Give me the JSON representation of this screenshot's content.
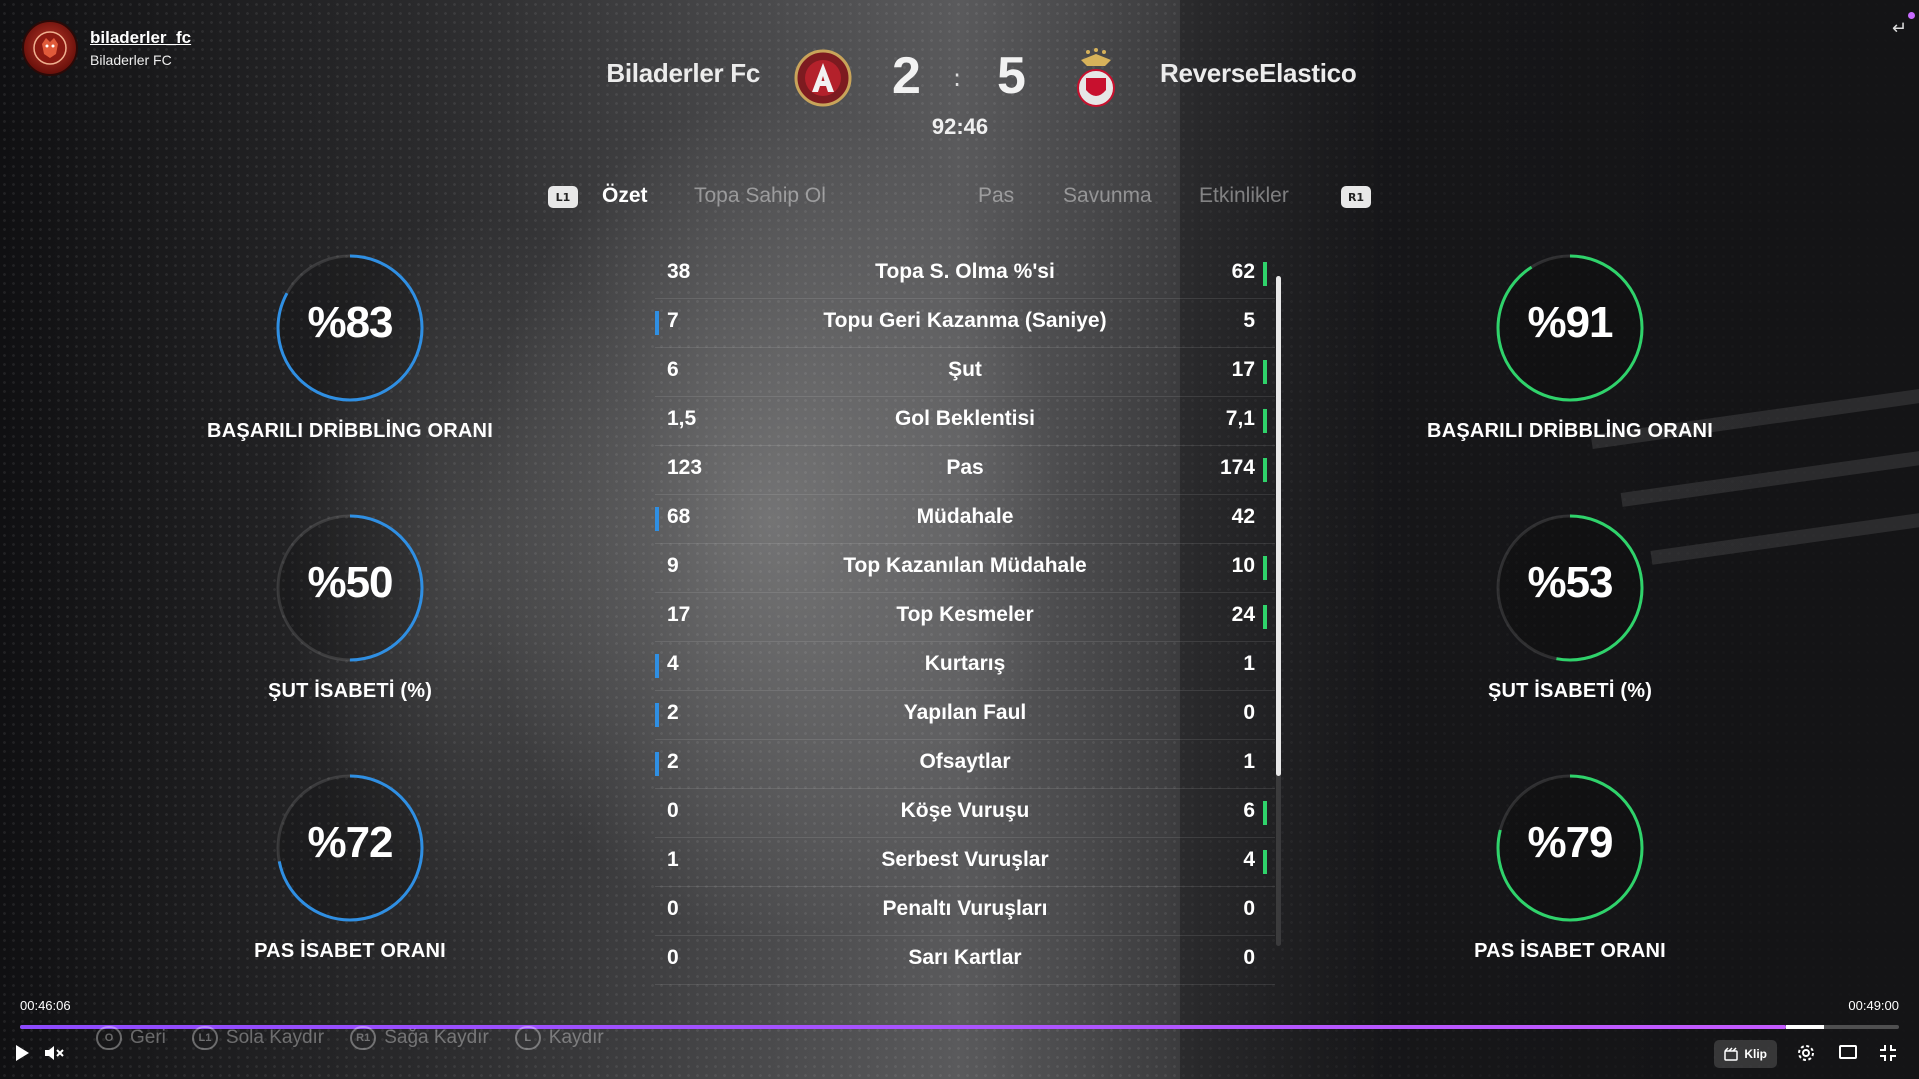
{
  "channel": {
    "name": "biladerler_fc",
    "subtitle": "Biladerler FC"
  },
  "match": {
    "home_team": "Biladerler Fc",
    "away_team": "ReverseElastico",
    "home_score": "2",
    "away_score": "5",
    "separator": ":",
    "clock": "92:46"
  },
  "tabs": {
    "prev_button": "L1",
    "next_button": "R1",
    "items": [
      "Özet",
      "Topa Sahip Ol",
      "Pas",
      "Savunma",
      "Etkinlikler"
    ],
    "active": "Özet"
  },
  "home_rings": [
    {
      "value": "%83",
      "label": "BAŞARILI DRİBBLİNG ORANI",
      "percent": 83
    },
    {
      "value": "%50",
      "label": "ŞUT İSABETİ (%)",
      "percent": 50
    },
    {
      "value": "%72",
      "label": "PAS İSABET ORANI",
      "percent": 72
    }
  ],
  "away_rings": [
    {
      "value": "%91",
      "label": "BAŞARILI DRİBBLİNG ORANI",
      "percent": 91
    },
    {
      "value": "%53",
      "label": "ŞUT İSABETİ (%)",
      "percent": 53
    },
    {
      "value": "%79",
      "label": "PAS İSABET ORANI",
      "percent": 79
    }
  ],
  "stats": [
    {
      "name": "Topa S. Olma %'si",
      "home": "38",
      "away": "62"
    },
    {
      "name": "Topu Geri Kazanma (Saniye)",
      "home": "7",
      "away": "5"
    },
    {
      "name": "Şut",
      "home": "6",
      "away": "17"
    },
    {
      "name": "Gol Beklentisi",
      "home": "1,5",
      "away": "7,1"
    },
    {
      "name": "Pas",
      "home": "123",
      "away": "174"
    },
    {
      "name": "Müdahale",
      "home": "68",
      "away": "42"
    },
    {
      "name": "Top Kazanılan Müdahale",
      "home": "9",
      "away": "10"
    },
    {
      "name": "Top Kesmeler",
      "home": "17",
      "away": "24"
    },
    {
      "name": "Kurtarış",
      "home": "4",
      "away": "1"
    },
    {
      "name": "Yapılan Faul",
      "home": "2",
      "away": "0"
    },
    {
      "name": "Ofsaytlar",
      "home": "2",
      "away": "1"
    },
    {
      "name": "Köşe Vuruşu",
      "home": "0",
      "away": "6"
    },
    {
      "name": "Serbest Vuruşlar",
      "home": "1",
      "away": "4"
    },
    {
      "name": "Penaltı Vuruşları",
      "home": "0",
      "away": "0"
    },
    {
      "name": "Sarı Kartlar",
      "home": "0",
      "away": "0"
    }
  ],
  "hints": [
    {
      "button": "O",
      "label": "Geri"
    },
    {
      "button": "L1",
      "label": "Sola Kaydır"
    },
    {
      "button": "R1",
      "label": "Sağa Kaydır"
    },
    {
      "button": "L",
      "label": "Kaydır"
    }
  ],
  "player": {
    "current_time": "00:46:06",
    "end_time": "00:49:00",
    "progress": 0.94,
    "buffered": 0.96,
    "clip_label": "Klip"
  },
  "colors": {
    "home_accent": "#2f8fe3",
    "away_accent": "#2fd36b",
    "progress": "#a050ff"
  },
  "icons": [
    "play-icon",
    "mute-icon",
    "clip-icon",
    "settings-icon",
    "theater-icon",
    "fullscreen-exit-icon",
    "exit-icon"
  ]
}
